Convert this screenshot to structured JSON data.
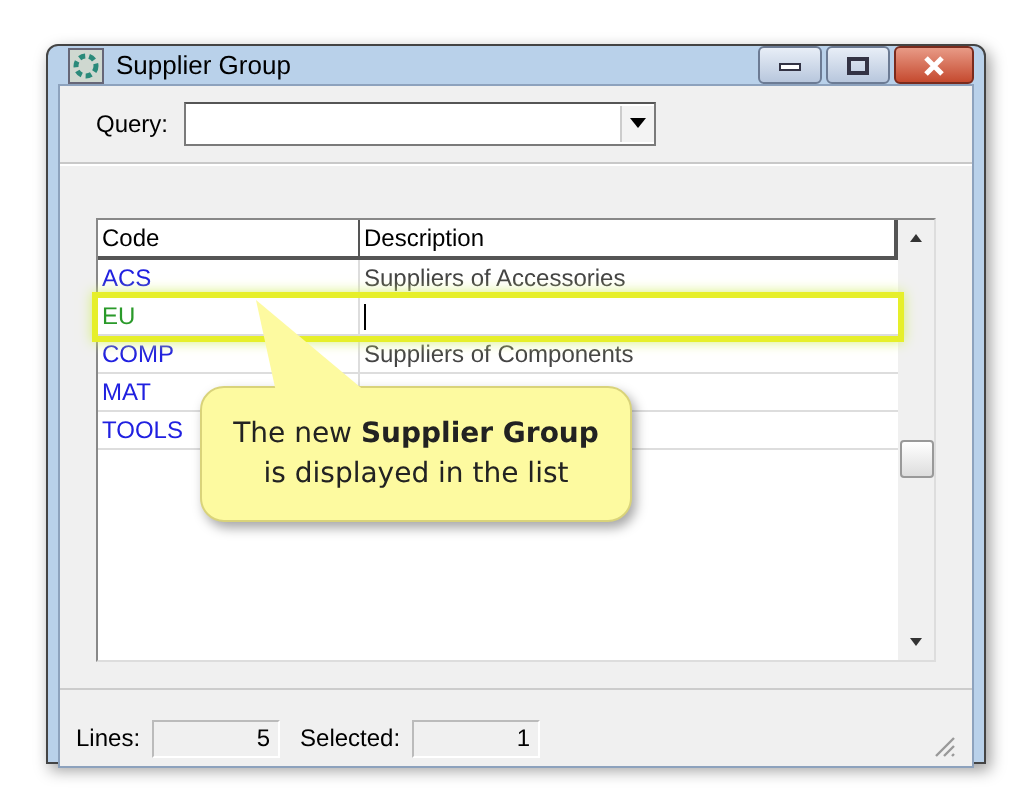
{
  "window": {
    "title": "Supplier Group"
  },
  "query": {
    "label": "Query:"
  },
  "table": {
    "columns": [
      "Code",
      "Description"
    ],
    "rows": [
      {
        "code": "ACS",
        "description": "Suppliers of Accessories",
        "selected": false
      },
      {
        "code": "EU",
        "description": "",
        "selected": true
      },
      {
        "code": "COMP",
        "description": "Suppliers of Components",
        "selected": false
      },
      {
        "code": "MAT",
        "description": "",
        "selected": false
      },
      {
        "code": "TOOLS",
        "description": "",
        "selected": false
      }
    ]
  },
  "callout": {
    "text": "The new **Supplier Group** is displayed in the list"
  },
  "status_bar": {
    "lines_label": "Lines:",
    "lines": "5",
    "selected_label": "Selected:",
    "selected": "1"
  }
}
